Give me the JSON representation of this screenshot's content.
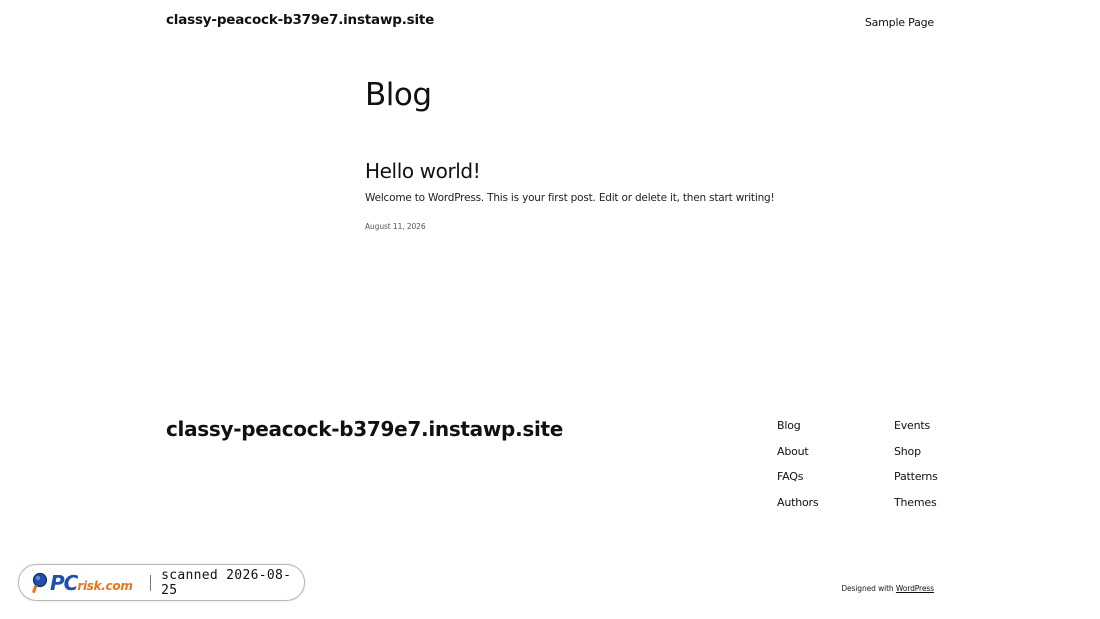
{
  "header": {
    "site_title": "classy-peacock-b379e7.instawp.site",
    "nav": [
      {
        "label": "Sample Page"
      }
    ]
  },
  "main": {
    "page_title": "Blog",
    "posts": [
      {
        "title": "Hello world!",
        "excerpt": "Welcome to WordPress. This is your first post. Edit or delete it, then start writing!",
        "date": "August 11, 2026"
      }
    ]
  },
  "footer": {
    "site_title": "classy-peacock-b379e7.instawp.site",
    "nav_columns": [
      [
        {
          "label": "Blog"
        },
        {
          "label": "About"
        },
        {
          "label": "FAQs"
        },
        {
          "label": "Authors"
        }
      ],
      [
        {
          "label": "Events"
        },
        {
          "label": "Shop"
        },
        {
          "label": "Patterns"
        },
        {
          "label": "Themes"
        }
      ]
    ],
    "credit_prefix": "Designed with ",
    "credit_link": "WordPress"
  },
  "watermark": {
    "brand_main": "PC",
    "brand_sub": "risk.com",
    "scan_text": "scanned 2026-08-25",
    "brand_color": "#1f4fa8",
    "accent_color": "#e8741d"
  }
}
